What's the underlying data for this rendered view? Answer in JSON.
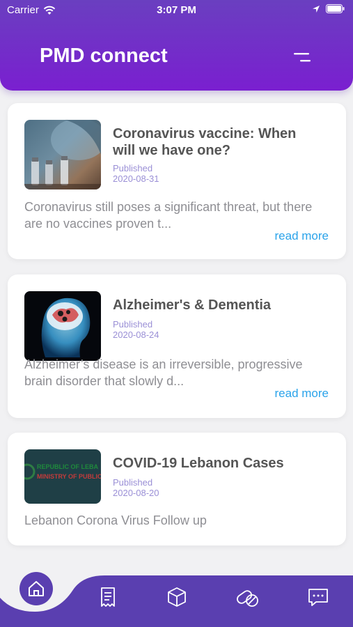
{
  "status_bar": {
    "carrier": "Carrier",
    "time": "3:07 PM"
  },
  "header": {
    "title": "PMD connect"
  },
  "articles": [
    {
      "title": "Coronavirus vaccine: When will we have one?",
      "published_label": "Published",
      "date": "2020-08-31",
      "excerpt": "Coronavirus still poses a significant threat, but there are no vaccines proven t...",
      "read_more": "read more"
    },
    {
      "title": "Alzheimer's & Dementia",
      "published_label": "Published",
      "date": "2020-08-24",
      "excerpt": "Alzheimer’s disease is an irreversible, progressive brain disorder that slowly d...",
      "read_more": "read more"
    },
    {
      "title": "COVID-19 Lebanon Cases",
      "published_label": "Published",
      "date": "2020-08-20",
      "excerpt": "Lebanon Corona Virus Follow up",
      "thumb_text_1": "REPUBLIC OF LEBA",
      "thumb_text_2": "MINISTRY OF PUBLIC HE"
    }
  ],
  "bottom_nav": {
    "items": [
      "home-icon",
      "receipt-icon",
      "box-icon",
      "pills-icon",
      "chat-icon"
    ]
  },
  "colors": {
    "header": "#6a3fc0",
    "nav": "#5a3fb0",
    "accent_link": "#2aa3ea",
    "published": "#9a8fd6"
  }
}
